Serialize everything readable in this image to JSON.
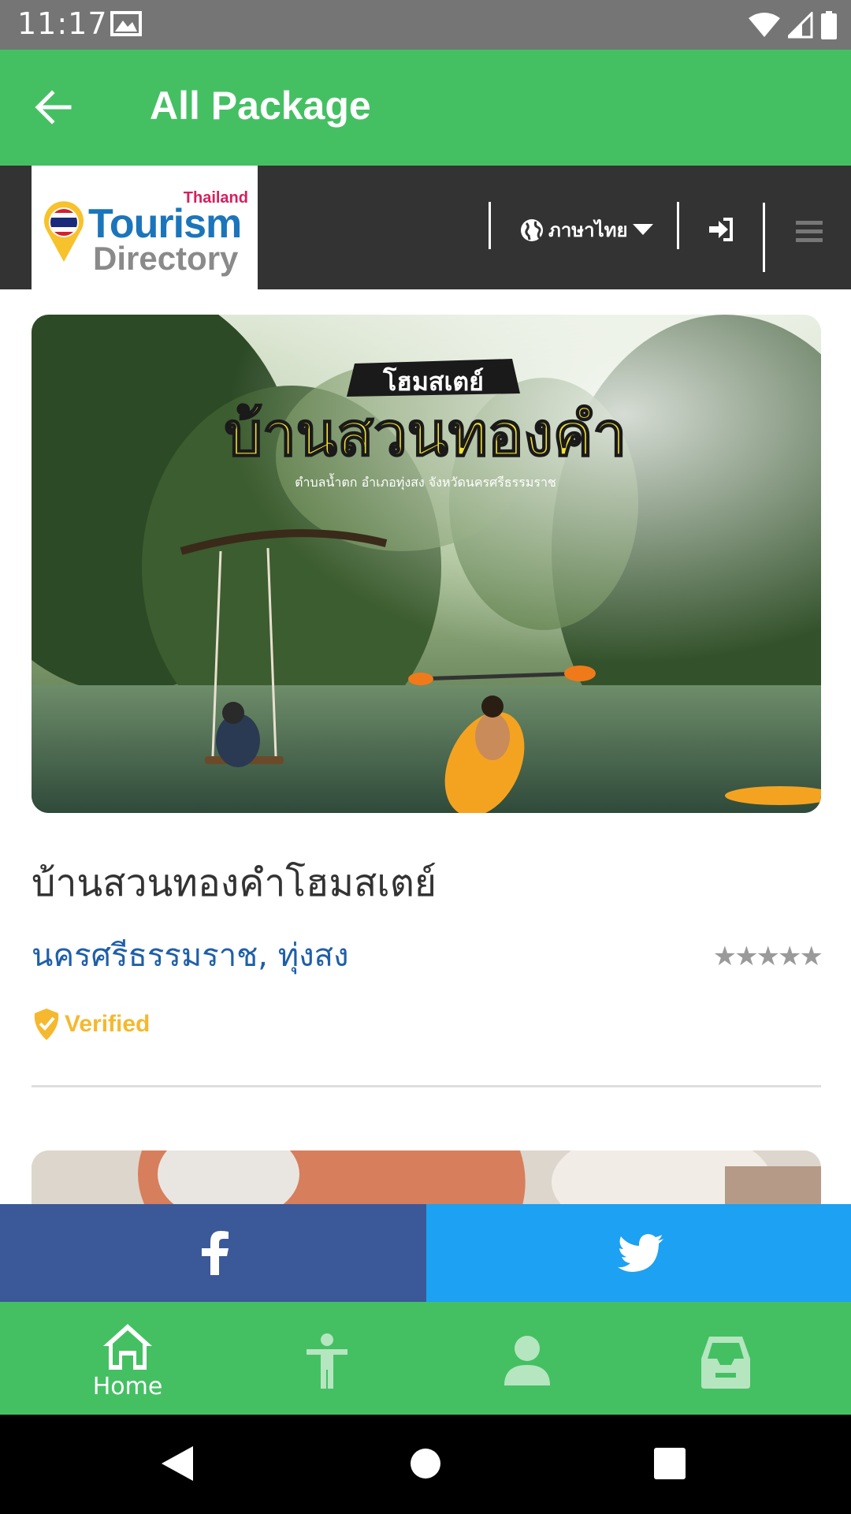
{
  "status_bar": {
    "time": "11:17"
  },
  "app_bar": {
    "title": "All Package"
  },
  "site_header": {
    "logo": {
      "top": "Thailand",
      "line1": "Tourism",
      "line2": "Directory"
    },
    "language_label": "ภาษาไทย"
  },
  "package": {
    "title": "บ้านสวนทองคำโฮมสเตย์",
    "location": "นครศรีธรรมราช, ทุ่งสง",
    "rating_stars": "★★★★★",
    "rating_value": 0,
    "verified_label": "Verified",
    "photo_text": {
      "tag": "โฮมสเตย์",
      "name": "บ้านสวนทองคำ",
      "address": "ตำบลน้ำตก อำเภอทุ่งสง จังหวัดนครศรีธรรมราช"
    }
  },
  "bottom_nav": {
    "items": [
      {
        "label": "Home",
        "icon": "home-icon",
        "active": true
      },
      {
        "label": "",
        "icon": "person-standing-icon",
        "active": false
      },
      {
        "label": "",
        "icon": "user-icon",
        "active": false
      },
      {
        "label": "",
        "icon": "inbox-icon",
        "active": false
      }
    ]
  },
  "colors": {
    "primary_green": "#44c063",
    "header_dark": "#333333",
    "facebook": "#3b5998",
    "twitter": "#1da1f2",
    "location_blue": "#1f5fa8",
    "verified_yellow": "#f5b82e"
  }
}
